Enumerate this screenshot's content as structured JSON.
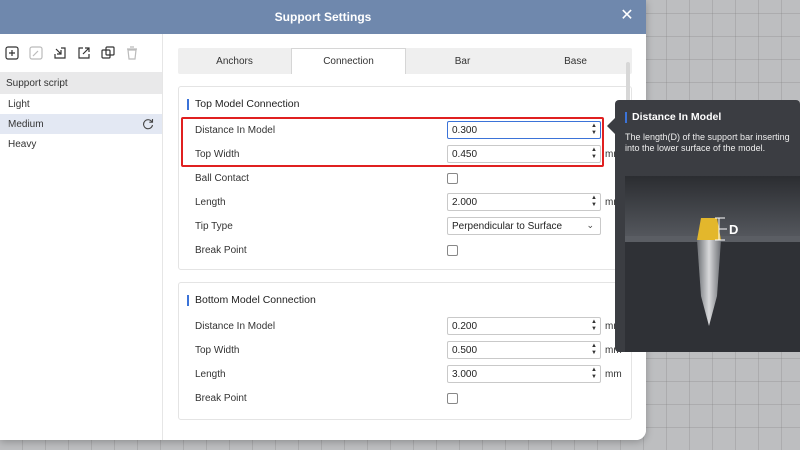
{
  "dialog": {
    "title": "Support Settings"
  },
  "left": {
    "section_title": "Support script",
    "items": [
      {
        "label": "Light"
      },
      {
        "label": "Medium"
      },
      {
        "label": "Heavy"
      }
    ]
  },
  "tabs": [
    {
      "label": "Anchors"
    },
    {
      "label": "Connection"
    },
    {
      "label": "Bar"
    },
    {
      "label": "Base"
    }
  ],
  "top_section": {
    "title": "Top Model Connection",
    "distance_label": "Distance In Model",
    "distance_value": "0.300",
    "width_label": "Top Width",
    "width_value": "0.450",
    "ball_label": "Ball Contact",
    "length_label": "Length",
    "length_value": "2.000",
    "tip_label": "Tip Type",
    "tip_value": "Perpendicular to Surface",
    "break_label": "Break Point",
    "unit": "mm"
  },
  "bottom_section": {
    "title": "Bottom Model Connection",
    "distance_label": "Distance In Model",
    "distance_value": "0.200",
    "width_label": "Top Width",
    "width_value": "0.500",
    "length_label": "Length",
    "length_value": "3.000",
    "break_label": "Break Point",
    "unit": "mm"
  },
  "tooltip": {
    "title": "Distance In Model",
    "description": "The length(D) of the support bar inserting into the lower surface of the model.",
    "diagram_label": "D"
  },
  "colors": {
    "titlebar": "#6f88ad",
    "accent": "#3b73d8",
    "highlight": "#e02020",
    "tooltip_bg": "#3b3d42"
  }
}
